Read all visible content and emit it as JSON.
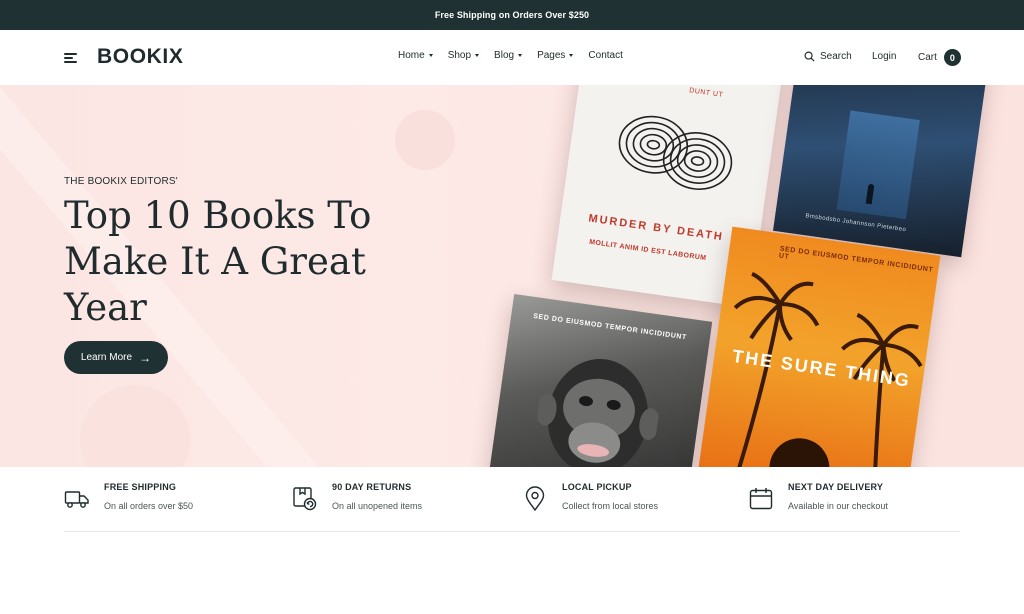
{
  "topbar": {
    "announcement": "Free Shipping on Orders Over $250"
  },
  "header": {
    "logo": "BOOKIX",
    "nav": [
      {
        "label": "Home",
        "has_dropdown": true
      },
      {
        "label": "Shop",
        "has_dropdown": true
      },
      {
        "label": "Blog",
        "has_dropdown": true
      },
      {
        "label": "Pages",
        "has_dropdown": true
      },
      {
        "label": "Contact",
        "has_dropdown": false
      }
    ],
    "search_label": "Search",
    "login_label": "Login",
    "cart_label": "Cart",
    "cart_count": "0"
  },
  "hero": {
    "eyebrow": "THE BOOKIX EDITORS'",
    "title": "Top 10 Books To Make It A Great Year",
    "cta_label": "Learn More",
    "books": [
      {
        "title": "MURDER BY DEATH",
        "subtitle": "MOLLIT ANIM ID EST LABORUM",
        "top_text": "DUNT UT"
      },
      {
        "title": "",
        "credit": "Bmsbodsbo Johannson Pieterbeo"
      },
      {
        "top_text": "SED DO EIUSMOD TEMPOR INCIDIDUNT"
      },
      {
        "title": "THE SURE THING",
        "top_text": "SED DO EIUSMOD TEMPOR INCIDIDUNT UT"
      }
    ]
  },
  "features": [
    {
      "icon": "truck-icon",
      "title": "FREE SHIPPING",
      "subtitle": "On all orders over $50"
    },
    {
      "icon": "returns-box-icon",
      "title": "90 DAY RETURNS",
      "subtitle": "On all unopened items"
    },
    {
      "icon": "map-pin-icon",
      "title": "LOCAL PICKUP",
      "subtitle": "Collect from local stores"
    },
    {
      "icon": "calendar-icon",
      "title": "NEXT DAY DELIVERY",
      "subtitle": "Available in our checkout"
    }
  ],
  "colors": {
    "primary_dark": "#1f3133",
    "hero_bg": "#fde9e6",
    "accent_red": "#c0392b"
  }
}
